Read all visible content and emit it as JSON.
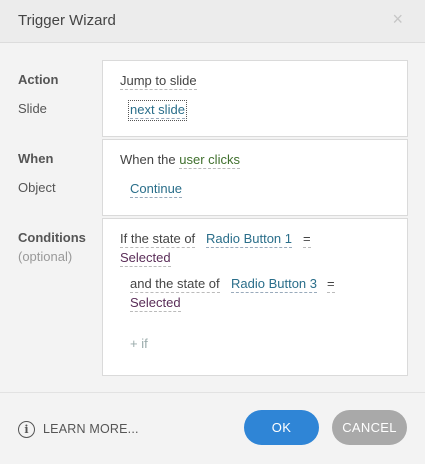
{
  "dialog": {
    "title": "Trigger Wizard",
    "close_glyph": "×"
  },
  "action_section": {
    "action_label": "Action",
    "slide_label": "Slide",
    "action_value": "Jump to slide",
    "slide_value": "next slide"
  },
  "when_section": {
    "when_label": "When",
    "object_label": "Object",
    "when_prefix": "When the",
    "when_value": "user clicks",
    "object_value": "Continue"
  },
  "conditions_section": {
    "label": "Conditions",
    "sublabel": "(optional)",
    "cond1": {
      "prefix": "If the state of",
      "object": "Radio Button 1",
      "op": "=",
      "state": "Selected"
    },
    "cond2": {
      "prefix": "and the state of",
      "object": "Radio Button 3",
      "op": "=",
      "state": "Selected"
    },
    "add_if": "+ if"
  },
  "footer": {
    "learn_more": "LEARN MORE...",
    "info_icon": "info-icon",
    "ok_label": "OK",
    "cancel_label": "CANCEL"
  },
  "colors": {
    "ok_button": "#2f85d6",
    "cancel_button": "#a9a9a9",
    "link": "#2a6e8a",
    "state_value": "#5a2d58",
    "event_value": "#3f6f2c"
  }
}
